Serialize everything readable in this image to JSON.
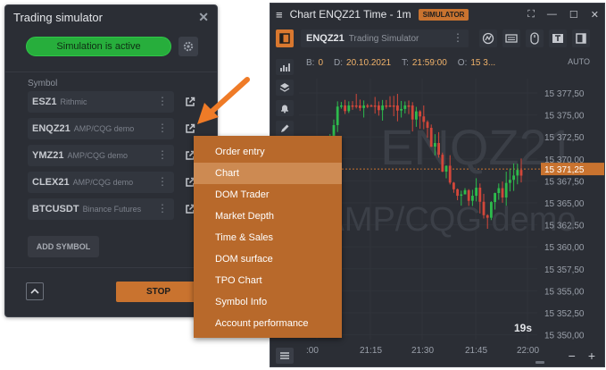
{
  "simulator": {
    "title": "Trading simulator",
    "status": "Simulation is active",
    "symbol_label": "Symbol",
    "symbols": [
      {
        "name": "ESZ1",
        "source": "Rithmic"
      },
      {
        "name": "ENQZ21",
        "source": "AMP/CQG demo"
      },
      {
        "name": "YMZ21",
        "source": "AMP/CQG demo"
      },
      {
        "name": "CLEX21",
        "source": "AMP/CQG demo"
      },
      {
        "name": "BTCUSDT",
        "source": "Binance Futures"
      }
    ],
    "add_symbol": "ADD SYMBOL",
    "stop": "STOP"
  },
  "chart": {
    "title": "Chart ENQZ21 Time - 1m",
    "badge": "SIMULATOR",
    "symbol": "ENQZ21",
    "symbol_sub": "Trading Simulator",
    "watermark_line1": "ENQZ21",
    "watermark_line2": "AMP/CQG demo",
    "ohlc": {
      "b_label": "B:",
      "b_value": "0",
      "d_label": "D:",
      "d_value": "20.10.2021",
      "t_label": "T:",
      "t_value": "21:59:00",
      "o_label": "O:",
      "o_value": "15 3..."
    },
    "scale_mode": "AUTO",
    "price_labels": [
      "15 377,50",
      "15 375,00",
      "15 372,50",
      "15 370,00",
      "15 367,50",
      "15 365,00",
      "15 362,50",
      "15 360,00",
      "15 357,50",
      "15 355,00",
      "15 352,50",
      "15 350,00"
    ],
    "current_price": "15 371,25",
    "time_labels": [
      ":00",
      "21:15",
      "21:30",
      "21:45",
      "22:00"
    ],
    "timer": "19s",
    "colors": {
      "up": "#2dbb4c",
      "down": "#d3473a",
      "accent": "#c9732f",
      "panel": "#2b2e35"
    }
  },
  "context_menu": {
    "items": [
      "Order entry",
      "Chart",
      "DOM Trader",
      "Market Depth",
      "Time & Sales",
      "DOM surface",
      "TPO Chart",
      "Symbol Info",
      "Account performance"
    ],
    "active": "Chart"
  }
}
